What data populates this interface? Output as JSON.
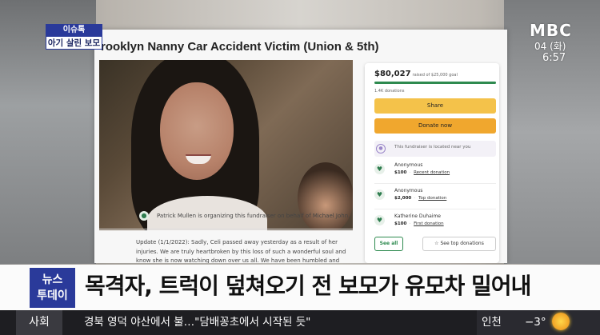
{
  "broadcast": {
    "logo": "MBC",
    "date": "04 (화)",
    "time": "6:57",
    "tag_top": "이슈톡",
    "tag_bottom": "아기 살린 보모",
    "news_badge_line1": "뉴스",
    "news_badge_line2": "투데이",
    "headline": "목격자, 트럭이 덮쳐오기 전 보모가 유모차 밀어내",
    "ticker_category": "사회",
    "ticker_text": "경북 영덕 야산에서 불…\"담배꽁초에서 시작된 듯\"",
    "weather_city": "인천",
    "weather_temp": "−3°",
    "weather_icon": "sun-icon"
  },
  "page": {
    "title": "rooklyn Nanny Car Accident Victim (Union & 5th)",
    "organizer_text": "Patrick Mullen is organizing this fundraiser on behalf of Michael John.",
    "update_text": "Update (1/1/2022): Sadly, Celi passed away yesterday as a result of her injuries. We are truly heartbroken by this loss of such a wonderful soul and know she is now watching down over us all. We have been humbled and overwhelmed by the amazing"
  },
  "card": {
    "amount": "$80,027",
    "goal": "raised of $25,000 goal",
    "progress": 1.0,
    "donations": "1.4K donations",
    "share_label": "Share",
    "donate_label": "Donate now",
    "location_text": "This fundraiser is located near you",
    "donors": [
      {
        "name": "Anonymous",
        "amount": "$100",
        "tag": "Recent donation"
      },
      {
        "name": "Anonymous",
        "amount": "$2,000",
        "tag": "Top donation"
      },
      {
        "name": "Katherine Duhaime",
        "amount": "$100",
        "tag": "First donation"
      }
    ],
    "see_all_label": "See all",
    "see_top_label": "See top donations"
  },
  "colors": {
    "accent_green": "#2e8a4f",
    "share_yellow": "#f4c24a",
    "donate_orange": "#f0a72e",
    "mbc_blue": "#2a3a9a"
  }
}
